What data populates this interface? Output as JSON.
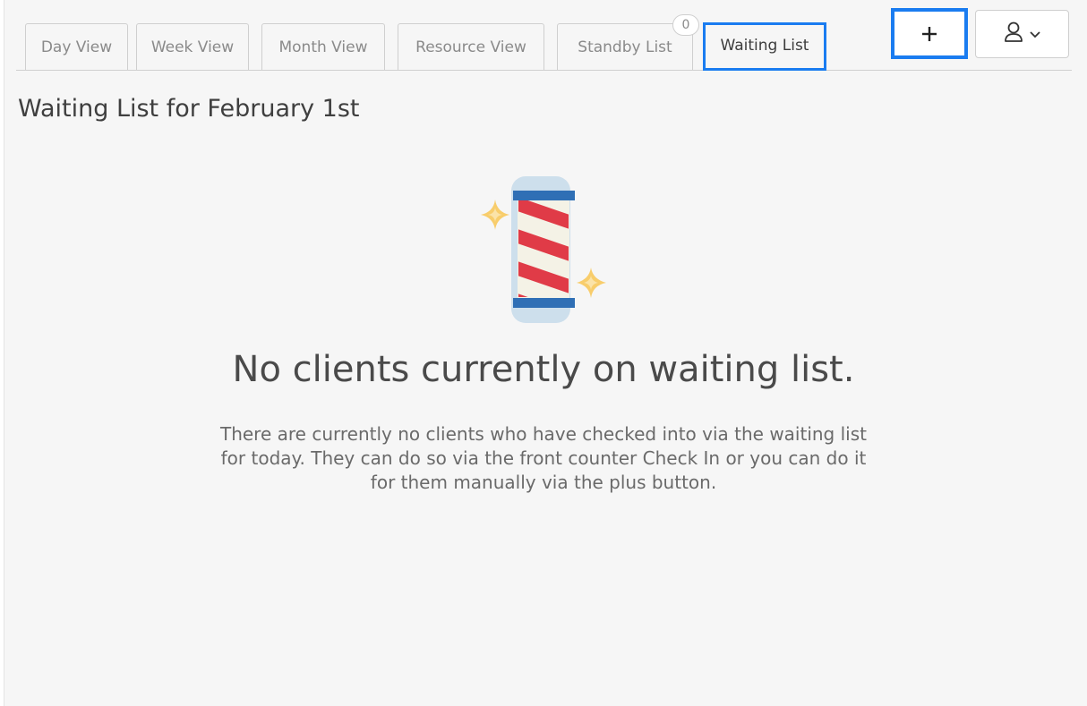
{
  "tabs": [
    {
      "label": "Day View",
      "active": false
    },
    {
      "label": "Week View",
      "active": false
    },
    {
      "label": "Month View",
      "active": false
    },
    {
      "label": "Resource View",
      "active": false
    },
    {
      "label": "Standby List",
      "active": false,
      "badge": "0"
    },
    {
      "label": "Waiting List",
      "active": true
    }
  ],
  "header": {
    "plus_icon": "plus-icon",
    "user_icon": "user-icon",
    "chevron_icon": "chevron-down-icon"
  },
  "page": {
    "title": "Waiting List for February 1st"
  },
  "empty_state": {
    "illustration": "barber-pole-icon",
    "heading": "No clients currently on waiting list.",
    "description": "There are currently no clients who have checked into via the waiting list for today. They can do so via the front counter Check In or you can do it for them manually via the plus button."
  },
  "colors": {
    "accent": "#1a7cf0",
    "pole_red": "#e03b47",
    "pole_cream": "#f4f2e6",
    "pole_cap": "#2f6fb5",
    "pole_glass": "#cddfec",
    "sparkle": "#f8cd6b"
  }
}
